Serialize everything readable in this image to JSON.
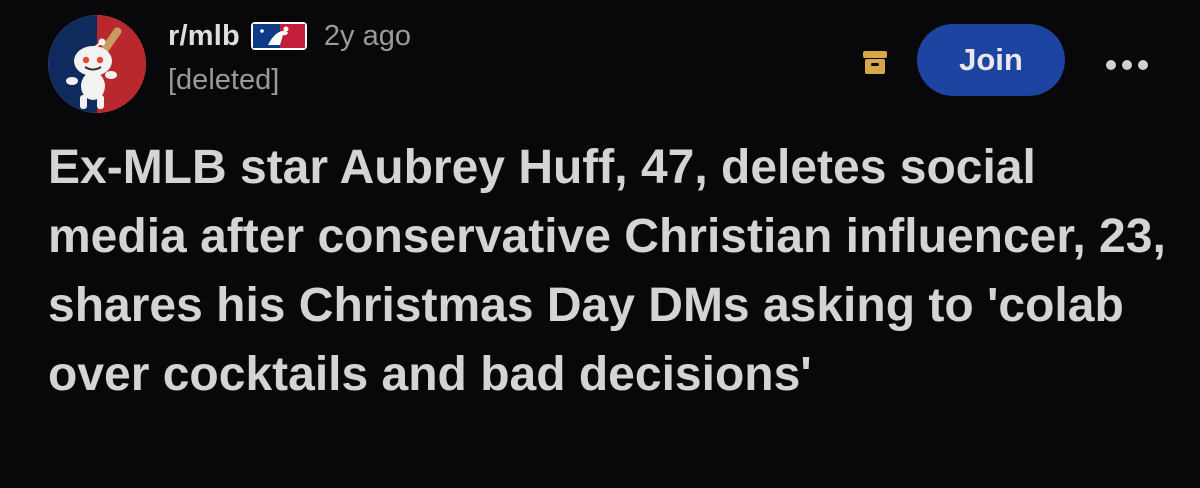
{
  "post": {
    "subreddit": "r/mlb",
    "time_ago": "2y ago",
    "author": "[deleted]",
    "join_label": "Join",
    "title": "Ex-MLB star Aubrey Huff, 47, deletes social media after conservative Christian influencer, 23, shares his Christmas Day DMs asking to 'colab over cocktails and bad decisions'"
  },
  "icons": {
    "avatar": "reddit-snoo-baseball-avatar",
    "flair": "mlb-logo-flair-icon",
    "archive": "archive-box-icon",
    "more": "more-options-icon"
  },
  "colors": {
    "background": "#08080a",
    "join_button": "#1d44a1",
    "archive_icon": "#d6a84a",
    "muted_text": "#9a9a9c"
  }
}
